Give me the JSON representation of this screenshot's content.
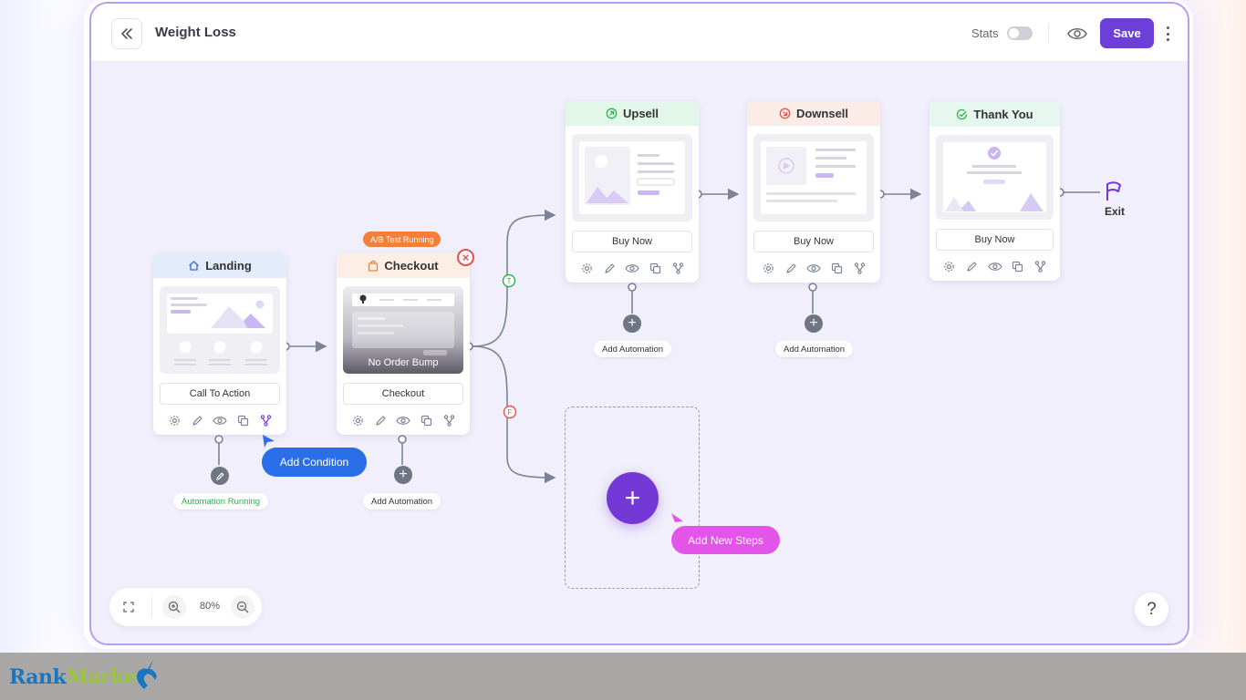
{
  "header": {
    "title": "Weight Loss",
    "stats_label": "Stats",
    "save_label": "Save"
  },
  "steps": {
    "landing": {
      "title": "Landing",
      "cta": "Call To Action",
      "head_color": "#e3ecfb"
    },
    "checkout": {
      "title": "Checkout",
      "cta": "Checkout",
      "badge": "A/B Test Running",
      "thumb_caption": "No Order Bump",
      "head_color": "#fdeee5"
    },
    "upsell": {
      "title": "Upsell",
      "cta": "Buy Now",
      "head_color": "#e3f6ea"
    },
    "downsell": {
      "title": "Downsell",
      "cta": "Buy Now",
      "head_color": "#fcece8"
    },
    "thankyou": {
      "title": "Thank You",
      "cta": "Buy Now",
      "head_color": "#e6f7ef"
    }
  },
  "branches": {
    "true_label": "T",
    "false_label": "F"
  },
  "labels": {
    "automation_running": "Automation Running",
    "add_automation": "Add Automation",
    "add_condition": "Add Condition",
    "add_new_steps": "Add New Steps",
    "exit": "Exit"
  },
  "zoom": {
    "level": "80%"
  },
  "help": "?",
  "brand": {
    "part1": "Rank",
    "part2": "Market"
  },
  "colors": {
    "accent": "#6c3fd8",
    "condition_button": "#2a6fe8",
    "new_steps_button": "#e355e8",
    "ab_badge": "#f0803c",
    "true_branch": "#2bb24c",
    "false_branch": "#e8514b"
  }
}
